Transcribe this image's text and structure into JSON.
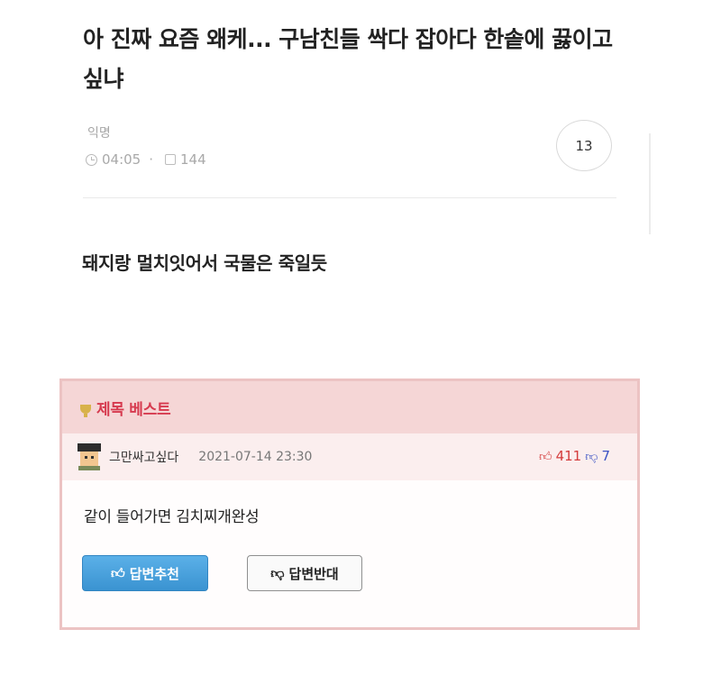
{
  "post": {
    "title": "아 진짜 요즘 왜케... 구남친들 싹다 잡아다 한솥에 끓이고싶냐",
    "author": "익명",
    "time": "04:05",
    "views": "144",
    "comment_count": "13",
    "body": "돼지랑 멀치잇어서 국물은 죽일듯"
  },
  "best": {
    "title": "제목 베스트",
    "username": "그만싸고싶다",
    "date": "2021-07-14 23:30",
    "upvotes": "411",
    "downvotes": "7",
    "reply": "같이 들어가면 김치찌개완성",
    "recommend_label": "답변추천",
    "oppose_label": "답변반대"
  },
  "colors": {
    "best_border": "#ecc3c3",
    "best_header": "#f5d6d6",
    "best_title": "#d63a4f",
    "recommend_button": "#3a93d1"
  },
  "icons": [
    "clock-icon",
    "comment-icon",
    "trophy-icon",
    "thumb-up-icon",
    "thumb-down-icon"
  ]
}
